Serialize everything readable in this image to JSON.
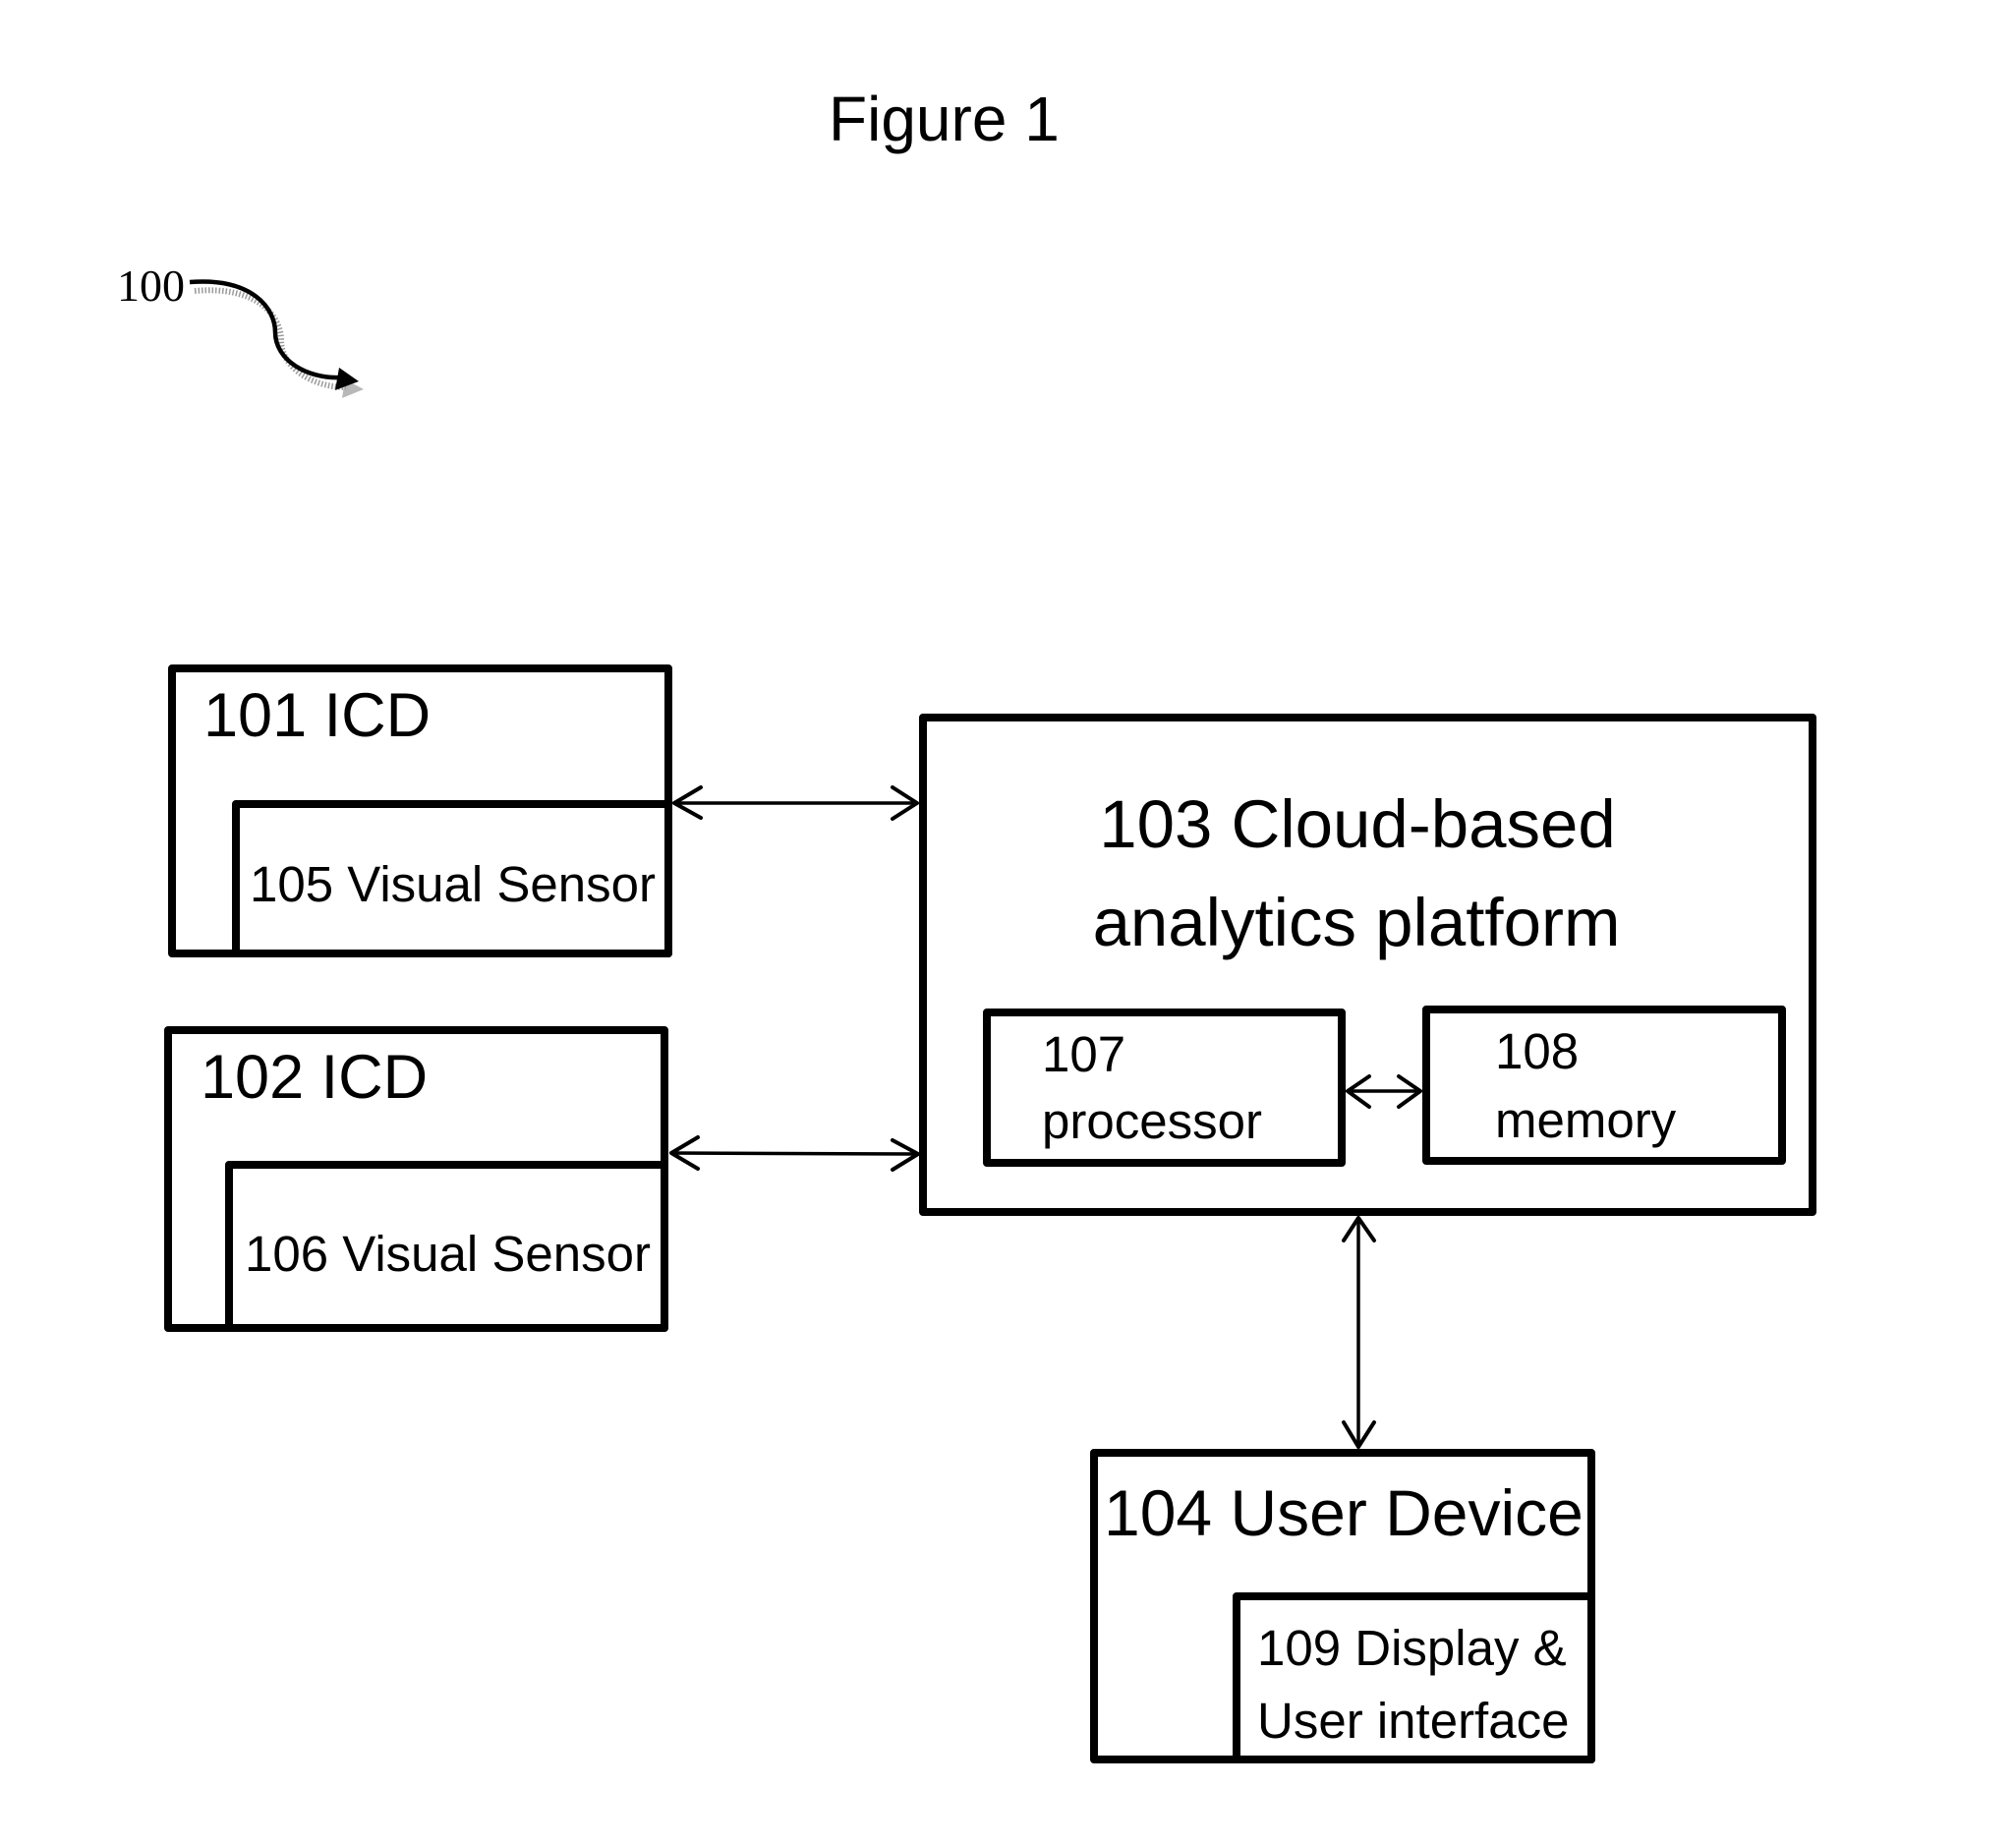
{
  "figure": {
    "title": "Figure 1",
    "reference_numeral": "100"
  },
  "blocks": {
    "icd_101": {
      "label": "101 ICD"
    },
    "sensor_105": {
      "label": "105 Visual Sensor"
    },
    "icd_102": {
      "label": "102 ICD"
    },
    "sensor_106": {
      "label": "106 Visual Sensor"
    },
    "platform_103": {
      "line1": "103 Cloud-based",
      "line2": "analytics platform"
    },
    "processor_107": {
      "line1": "107",
      "line2": "processor"
    },
    "memory_108": {
      "line1": "108",
      "line2": "memory"
    },
    "user_device_104": {
      "label": "104 User Device"
    },
    "display_109": {
      "line1": "109 Display &",
      "line2": "User interface"
    }
  },
  "connections": [
    {
      "from": "101 ICD",
      "to": "103 Cloud-based analytics platform",
      "type": "bidirectional"
    },
    {
      "from": "102 ICD",
      "to": "103 Cloud-based analytics platform",
      "type": "bidirectional"
    },
    {
      "from": "107 processor",
      "to": "108 memory",
      "type": "bidirectional"
    },
    {
      "from": "103 Cloud-based analytics platform",
      "to": "104 User Device",
      "type": "bidirectional"
    }
  ],
  "colors": {
    "stroke": "#000000",
    "background": "#ffffff",
    "shadow": "#9a9a9a"
  }
}
